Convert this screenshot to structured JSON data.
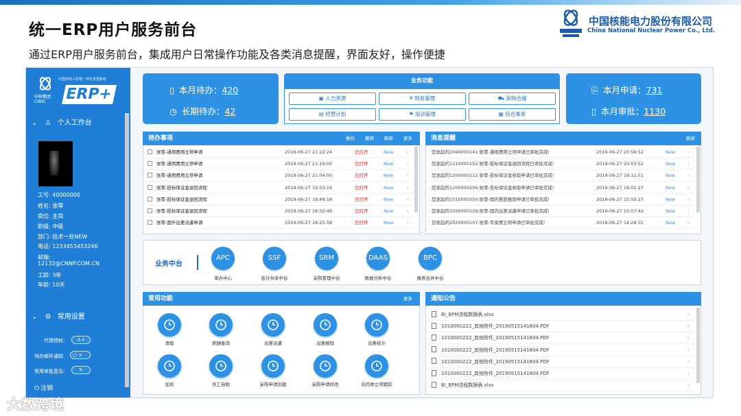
{
  "slide": {
    "title": "统一ERP用户服务前台",
    "subtitle": "通过ERP用户服务前台，集成用户日常操作功能及各类消息提醒，界面友好，操作便捷",
    "company_cn": "中国核能电力股份有限公司",
    "company_en": "China National Nuclear Power Co., Ltd.",
    "watermark": "大数跨境"
  },
  "sidebar": {
    "logo_tiny": "中国核电人财物一体化管理系统",
    "logo_org": "中核集团",
    "logo_org_en": "CNNC",
    "erp": "ERP+",
    "workbench": "个人工作台",
    "info": [
      "工号: 40000000",
      "姓名: 张零",
      "岗位: 主岗",
      "职级: 中级",
      "部门: 技术一处NEW",
      "电话: 1233453453246",
      "邮箱:",
      "12132@CNNP.COM.CN",
      "工龄: 3年",
      "年龄: 10天"
    ],
    "settings": "常用设置",
    "opt_delegate": "代理授权:",
    "opt_mail": "待办邮件通知",
    "opt_sign": "常用审批意见:",
    "logout": "注销"
  },
  "stats": {
    "month_todo_label": "本月待办：",
    "month_todo": "420",
    "long_todo_label": "长期待办：",
    "long_todo": "42",
    "month_apply_label": "本月申请：",
    "month_apply": "731",
    "month_approve_label": "本月审批：",
    "month_approve": "1130"
  },
  "biz": {
    "title": "业务功能",
    "buttons": [
      "人力资源",
      "财务管理",
      "采购合储",
      "经营计划",
      "培训管理",
      "综合事务"
    ]
  },
  "todo": {
    "title": "待办事项",
    "actions": [
      "委托",
      "撤销",
      "刷新",
      "更多"
    ],
    "rows": [
      {
        "name": "张零-通用费用立项申请",
        "time": "2019-06-27 21:22:24",
        "status": "已打开",
        "tag": "New"
      },
      {
        "name": "张零-通用费用立项申请",
        "time": "2019-06-27 21:19:05",
        "status": "已打开",
        "tag": "New"
      },
      {
        "name": "张零-通用费用立项申请",
        "time": "2019-06-27 21:04:00",
        "status": "已打开",
        "tag": "New"
      },
      {
        "name": "张零-投标保证金退回流程",
        "time": "2019-06-27 19:33:19",
        "status": "已打开",
        "tag": "New"
      },
      {
        "name": "张零-投标保证金退回流程",
        "time": "2019-06-27 18:49:18",
        "status": "已打开",
        "tag": "New"
      },
      {
        "name": "张零-投标保证金退回流程",
        "time": "2019-06-27 18:32:49",
        "status": "已打开",
        "tag": "New"
      },
      {
        "name": "张零-国外出差派遣申请",
        "time": "2019-06-27 18:25:58",
        "status": "已打开",
        "tag": "New"
      }
    ]
  },
  "msgs": {
    "title": "消息提醒",
    "action": "刷新",
    "rows": [
      {
        "text": "您发起的2040000241:张零-通用费用立项申请已审批完成!",
        "time": "2019-06-27 20:58:52",
        "tag": "New"
      },
      {
        "text": "您发起的1210000152:张零-投标保证金退回流程已审批完成!",
        "time": "2019-06-27 20:03:52",
        "tag": "New"
      },
      {
        "text": "您发起的1200000212:张零-投标保证金收取申请已审批完成!",
        "time": "2019-06-27 19:11:51",
        "tag": "New"
      },
      {
        "text": "您发起的1200000206:张零-投标保证金收取申请已审批完成!",
        "time": "2019-06-27 18:01:27",
        "tag": "New"
      },
      {
        "text": "您发起的1010000350:张零-国内差旅报销申请已审批完成!",
        "time": "2019-06-27 15:55:27",
        "tag": "New"
      },
      {
        "text": "您发起的1030000129:张零-国内出差派遣申请已审批完成!",
        "time": "2019-06-27 15:07:42",
        "tag": "New"
      },
      {
        "text": "您发起的2020000107:张零-专家费立项申请已审批完成!",
        "time": "2019-06-27 14:28:31",
        "tag": "New"
      }
    ]
  },
  "platform": {
    "label": "业务中台",
    "items": [
      {
        "abbr": "APC",
        "name": "审办中心"
      },
      {
        "abbr": "SSF",
        "name": "会计共享中台"
      },
      {
        "abbr": "SRM",
        "name": "采购管理中台"
      },
      {
        "abbr": "DAAS",
        "name": "数据分析中台"
      },
      {
        "abbr": "BPC",
        "name": "报表合并中台"
      }
    ]
  },
  "common": {
    "title": "常用功能",
    "more": "更多",
    "items": [
      "请假",
      "薪酬查询",
      "出差派遣",
      "出差报销",
      "出差统计",
      "加班",
      "员工自助",
      "采购申请创建",
      "采购申请修改",
      "合同类立项跟踪"
    ]
  },
  "notice": {
    "title": "通知公告",
    "rows": [
      "BI_BPM流程数据表.xlsx",
      "1010000222_其他附件_20190515141804.PDF",
      "1010000222_其他附件_20190515141804.PDF",
      "1010000222_其他附件_20190515141804.PDF",
      "1010000222_其他附件_20190515141804.PDF",
      "1010000222_其他附件_20190515141804.PDF",
      "BI_BPM流程数据表.xlsx"
    ]
  },
  "colors": {
    "brand": "#1f7fd6",
    "accent": "#2d92e3",
    "status_open": "#e02020"
  }
}
